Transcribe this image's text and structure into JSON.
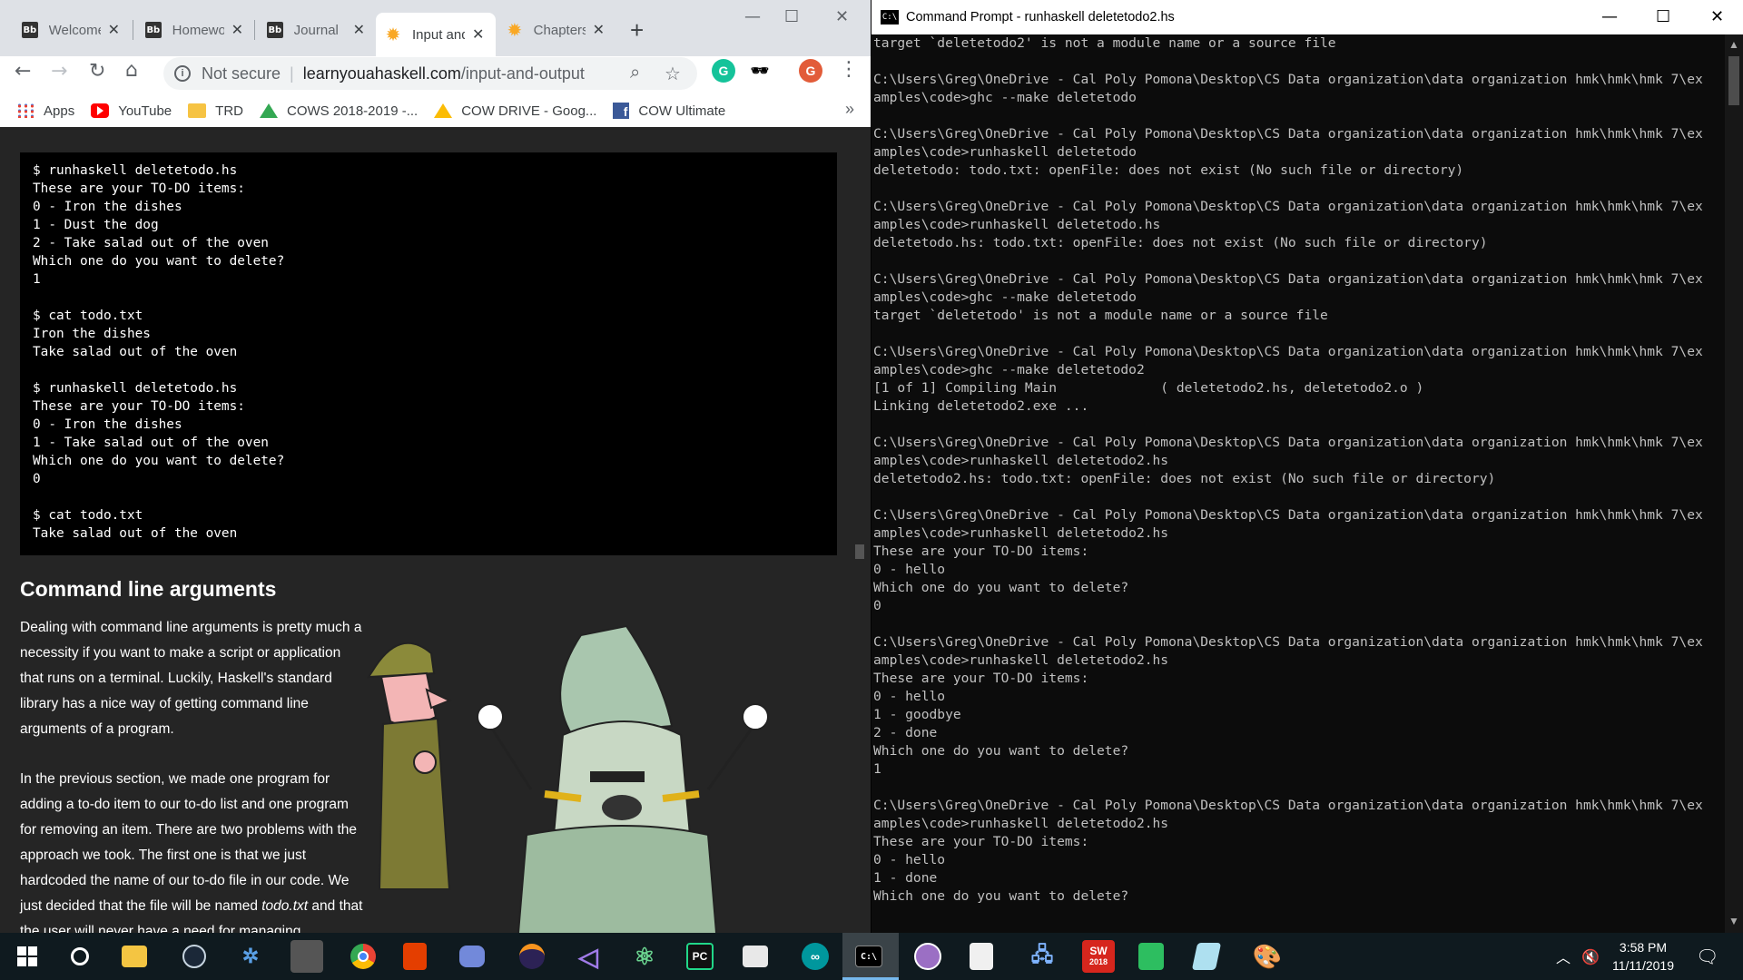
{
  "browser": {
    "tabs": [
      {
        "label": "Welcome",
        "favicon": "Bb"
      },
      {
        "label": "Homework",
        "favicon": "Bb"
      },
      {
        "label": "Journal",
        "favicon": "Bb"
      },
      {
        "label": "Input and Output",
        "favicon": "sun"
      },
      {
        "label": "Chapters",
        "favicon": "sun"
      }
    ],
    "active_tab": 3,
    "omnibox": {
      "security": "Not secure",
      "host": "learnyouahaskell.com",
      "path": "/input-and-output"
    },
    "bookmarks": [
      {
        "label": "Apps",
        "icon": "apps-grid-icon"
      },
      {
        "label": "YouTube",
        "icon": "youtube-icon"
      },
      {
        "label": "TRD",
        "icon": "folder-icon"
      },
      {
        "label": "COWS 2018-2019 -...",
        "icon": "drive-icon"
      },
      {
        "label": "COW DRIVE - Goog...",
        "icon": "drive-icon"
      },
      {
        "label": "COW Ultimate",
        "icon": "facebook-icon"
      }
    ],
    "profile_initial": "G",
    "page": {
      "code": "$ runhaskell deletetodo.hs\nThese are your TO-DO items:\n0 - Iron the dishes\n1 - Dust the dog\n2 - Take salad out of the oven\nWhich one do you want to delete?\n1\n\n$ cat todo.txt\nIron the dishes\nTake salad out of the oven\n\n$ runhaskell deletetodo.hs\nThese are your TO-DO items:\n0 - Iron the dishes\n1 - Take salad out of the oven\nWhich one do you want to delete?\n0\n\n$ cat todo.txt\nTake salad out of the oven",
      "heading": "Command line arguments",
      "para1": "Dealing with command line arguments is pretty much a necessity if you want to make a script or application that runs on a terminal. Luckily, Haskell's standard library has a nice way of getting command line arguments of a program.",
      "para2_before": "In the previous section, we made one program for adding a to-do item to our to-do list and one program for removing an item. There are two problems with the approach we took. The first one is that we just hardcoded the name of our to-do file in our code. We just decided that the file will be named ",
      "para2_em": "todo.txt",
      "para2_after": " and that the user will never have a need for managing"
    }
  },
  "cmd": {
    "title": "Command Prompt - runhaskell  deletetodo2.hs",
    "output": "target `deletetodo2' is not a module name or a source file\n\nC:\\Users\\Greg\\OneDrive - Cal Poly Pomona\\Desktop\\CS Data organization\\data organization hmk\\hmk\\hmk 7\\ex\namples\\code>ghc --make deletetodo\n\nC:\\Users\\Greg\\OneDrive - Cal Poly Pomona\\Desktop\\CS Data organization\\data organization hmk\\hmk\\hmk 7\\ex\namples\\code>runhaskell deletetodo\ndeletetodo: todo.txt: openFile: does not exist (No such file or directory)\n\nC:\\Users\\Greg\\OneDrive - Cal Poly Pomona\\Desktop\\CS Data organization\\data organization hmk\\hmk\\hmk 7\\ex\namples\\code>runhaskell deletetodo.hs\ndeletetodo.hs: todo.txt: openFile: does not exist (No such file or directory)\n\nC:\\Users\\Greg\\OneDrive - Cal Poly Pomona\\Desktop\\CS Data organization\\data organization hmk\\hmk\\hmk 7\\ex\namples\\code>ghc --make deletetodo\ntarget `deletetodo' is not a module name or a source file\n\nC:\\Users\\Greg\\OneDrive - Cal Poly Pomona\\Desktop\\CS Data organization\\data organization hmk\\hmk\\hmk 7\\ex\namples\\code>ghc --make deletetodo2\n[1 of 1] Compiling Main             ( deletetodo2.hs, deletetodo2.o )\nLinking deletetodo2.exe ...\n\nC:\\Users\\Greg\\OneDrive - Cal Poly Pomona\\Desktop\\CS Data organization\\data organization hmk\\hmk\\hmk 7\\ex\namples\\code>runhaskell deletetodo2.hs\ndeletetodo2.hs: todo.txt: openFile: does not exist (No such file or directory)\n\nC:\\Users\\Greg\\OneDrive - Cal Poly Pomona\\Desktop\\CS Data organization\\data organization hmk\\hmk\\hmk 7\\ex\namples\\code>runhaskell deletetodo2.hs\nThese are your TO-DO items:\n0 - hello\nWhich one do you want to delete?\n0\n\nC:\\Users\\Greg\\OneDrive - Cal Poly Pomona\\Desktop\\CS Data organization\\data organization hmk\\hmk\\hmk 7\\ex\namples\\code>runhaskell deletetodo2.hs\nThese are your TO-DO items:\n0 - hello\n1 - goodbye\n2 - done\nWhich one do you want to delete?\n1\n\nC:\\Users\\Greg\\OneDrive - Cal Poly Pomona\\Desktop\\CS Data organization\\data organization hmk\\hmk\\hmk 7\\ex\namples\\code>runhaskell deletetodo2.hs\nThese are your TO-DO items:\n0 - hello\n1 - done\nWhich one do you want to delete?"
  },
  "taskbar": {
    "apps": [
      "start-icon",
      "cortana-icon",
      "file-explorer-icon",
      "steam-icon",
      "blender-icon",
      "game-icon",
      "chrome-icon",
      "office-icon",
      "discord-icon",
      "eclipse-icon",
      "visual-studio-icon",
      "atom-icon",
      "pycharm-icon",
      "photos-icon",
      "arduino-icon",
      "command-prompt-icon",
      "oneNote-icon",
      "acrobat-icon",
      "network-icon",
      "solidworks-icon",
      "evernote-icon",
      "notepad-icon",
      "paint-icon"
    ],
    "solidworks_label": "2018",
    "time": "3:58 PM",
    "date": "11/11/2019"
  },
  "colors": {
    "page_bg": "#252525",
    "code_bg": "#000000",
    "cmd_bg": "#0c0c0c",
    "taskbar_bg": "#0f1a1f",
    "accent": "#76b9ed"
  }
}
